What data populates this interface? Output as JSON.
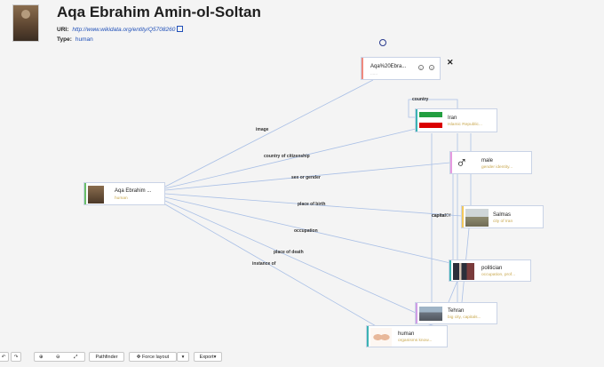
{
  "header": {
    "title": "Aqa Ebrahim Amin-ol-Soltan",
    "uri_label": "URI:",
    "uri": "http://www.wikidata.org/entity/Q5708260",
    "type_label": "Type:",
    "type_value": "human"
  },
  "edge_labels": {
    "country": "country",
    "image": "image",
    "citizenship": "country of citizenship",
    "sex": "sex or gender",
    "birth": "place of birth",
    "capital": "capital",
    "capitalof": "capitalOf",
    "occupation": "occupation",
    "death": "place of death",
    "instance": "instance of"
  },
  "nodes": {
    "subject": {
      "name": "Aqa Ebrahim ...",
      "sub": "human"
    },
    "image": {
      "name": "Aqa%20Ebra..."
    },
    "iran": {
      "name": "Iran",
      "sub": "Islamic Republic..."
    },
    "male": {
      "name": "male",
      "sub": "gender identity..."
    },
    "salmas": {
      "name": "Salmas",
      "sub": "city of Iran"
    },
    "politician": {
      "name": "politician",
      "sub": "occupation, prof..."
    },
    "tehran": {
      "name": "Tehran",
      "sub": "big city, capitals..."
    },
    "human": {
      "name": "human",
      "sub": "organisms know..."
    }
  },
  "male_symbol": "♂",
  "toolbar": {
    "pathfinder": "Pathfinder",
    "force_layout": "Force layout",
    "export": "Export"
  },
  "icons": [
    "undo-icon",
    "redo-icon",
    "zoom-in-icon",
    "zoom-out-icon",
    "fit-icon",
    "force-layout-icon",
    "close-icon"
  ],
  "colors": {
    "link": "#1f4fb8",
    "edge": "#aac0e6",
    "subtitle": "#c9a84f",
    "bar_subject": "#6abf69",
    "bar_image": "#f08a7e",
    "bar_iran": "#3bb3b3",
    "bar_male": "#e79be0",
    "bar_salmas": "#f2c85b",
    "bar_politician": "#3bb3b3",
    "bar_tehran": "#cf9de6",
    "bar_human": "#3bb3b3"
  }
}
